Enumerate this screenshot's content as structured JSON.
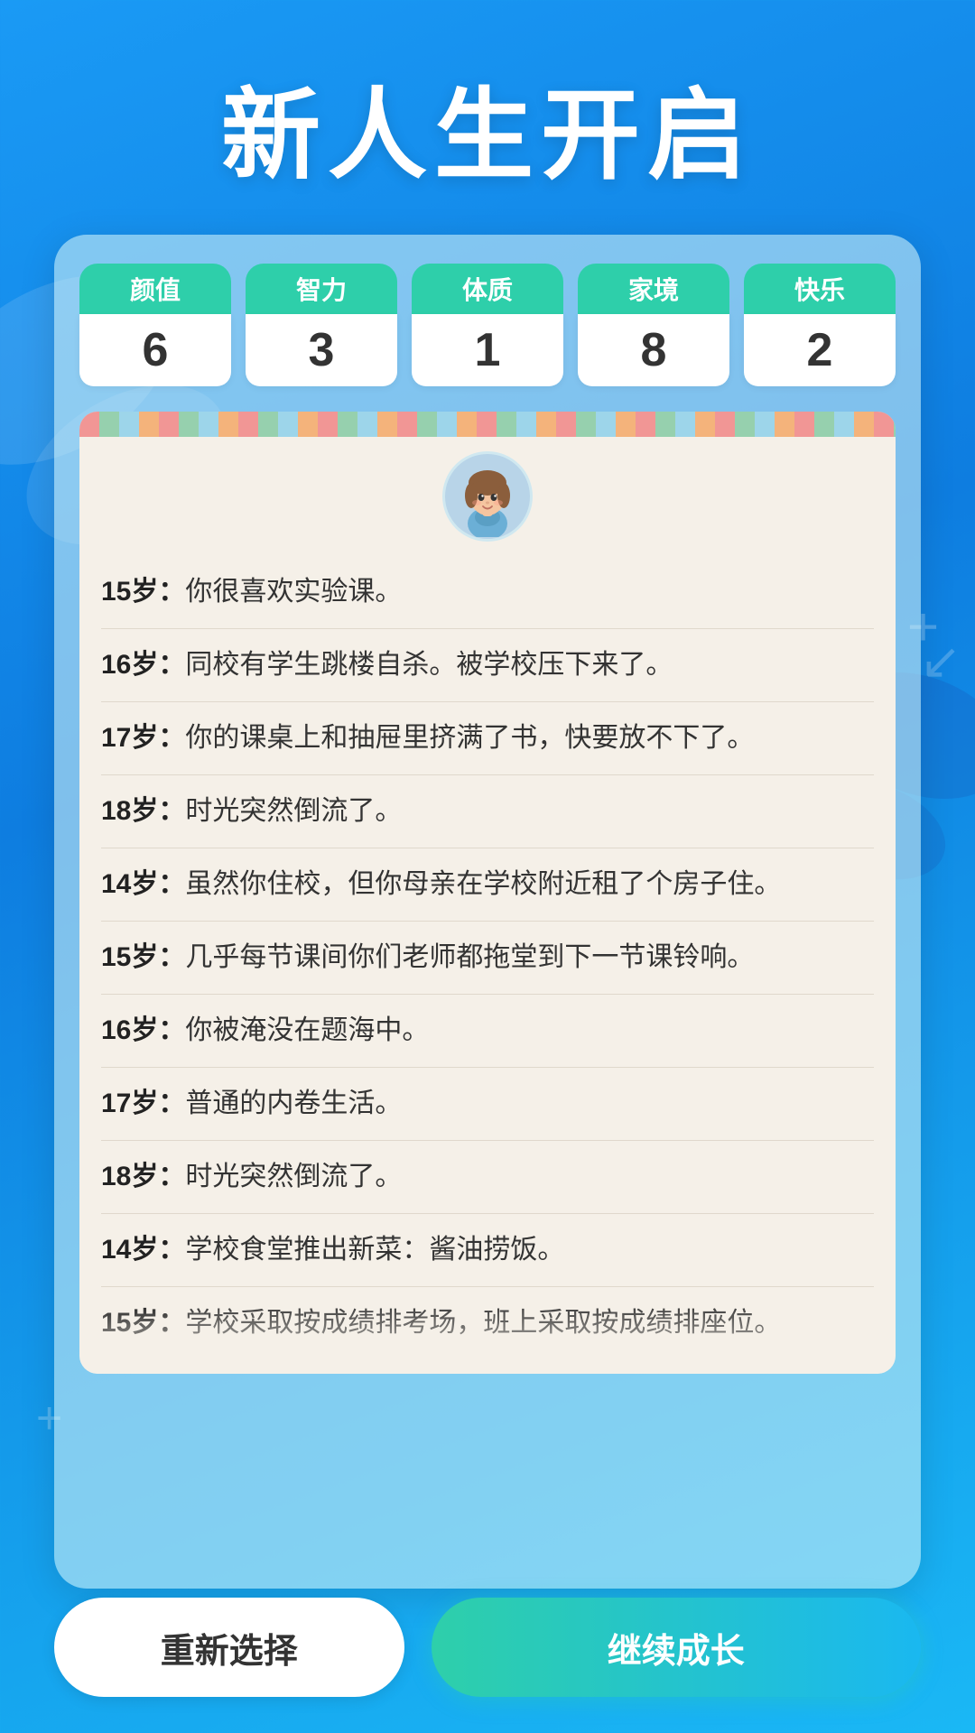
{
  "page": {
    "title": "新人生开启",
    "background_color": "#1a9af5"
  },
  "stats": [
    {
      "label": "颜值",
      "value": "6"
    },
    {
      "label": "智力",
      "value": "3"
    },
    {
      "label": "体质",
      "value": "1"
    },
    {
      "label": "家境",
      "value": "8"
    },
    {
      "label": "快乐",
      "value": "2"
    }
  ],
  "story_items": [
    {
      "age": "15岁",
      "text": "你很喜欢实验课。"
    },
    {
      "age": "16岁",
      "text": "同校有学生跳楼自杀。被学校压下来了。"
    },
    {
      "age": "17岁",
      "text": "你的课桌上和抽屉里挤满了书，快要放不下了。"
    },
    {
      "age": "18岁",
      "text": "时光突然倒流了。"
    },
    {
      "age": "14岁",
      "text": "虽然你住校，但你母亲在学校附近租了个房子住。"
    },
    {
      "age": "15岁",
      "text": "几乎每节课间你们老师都拖堂到下一节课铃响。"
    },
    {
      "age": "16岁",
      "text": "你被淹没在题海中。"
    },
    {
      "age": "17岁",
      "text": "普通的内卷生活。"
    },
    {
      "age": "18岁",
      "text": "时光突然倒流了。"
    },
    {
      "age": "14岁",
      "text": "学校食堂推出新菜：酱油捞饭。"
    },
    {
      "age": "15岁",
      "text": "学校采取按成绩排考场，班上采取按成绩排座位。"
    }
  ],
  "buttons": {
    "restart": "重新选择",
    "continue": "继续成长"
  }
}
